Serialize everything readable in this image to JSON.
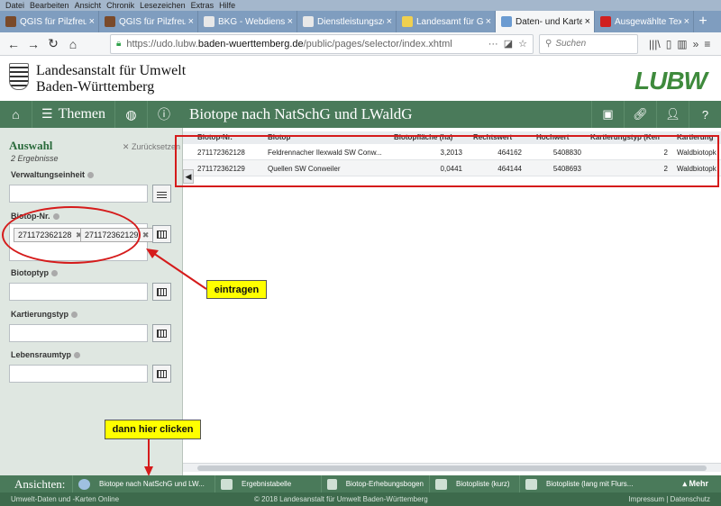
{
  "menubar": [
    "Datei",
    "Bearbeiten",
    "Ansicht",
    "Chronik",
    "Lesezeichen",
    "Extras",
    "Hilfe"
  ],
  "tabs": [
    {
      "label": "QGIS für Pilzfreunde",
      "favicon": "forum-icon",
      "color": "#7a4a2a"
    },
    {
      "label": "QGIS für Pilzfreunde",
      "favicon": "forum-icon",
      "color": "#7a4a2a"
    },
    {
      "label": "BKG - Webdienste",
      "favicon": "bkg-icon",
      "color": "#e8e8e8"
    },
    {
      "label": "Dienstleistungszen",
      "favicon": "lubw-icon",
      "color": "#e8e8e8"
    },
    {
      "label": "Landesamt für Geo",
      "favicon": "lgl-icon",
      "color": "#f0d050"
    },
    {
      "label": "Daten- und Karten",
      "favicon": "map-icon",
      "color": "#6b9bd1",
      "active": true
    },
    {
      "label": "Ausgewählte Texte",
      "favicon": "zt-icon",
      "color": "#d02020"
    }
  ],
  "browser": {
    "url_prefix": "https://udo.lubw.",
    "url_domain": "baden-wuerttemberg.de",
    "url_path": "/public/pages/selector/index.xhtml",
    "search_placeholder": "Suchen"
  },
  "header": {
    "org_line1": "Landesanstalt für Umwelt",
    "org_line2": "Baden-Württemberg",
    "logo_text": "LUBW"
  },
  "toolbar": {
    "themen_label": "Themen",
    "page_title": "Biotope nach NatSchG und LWaldG"
  },
  "filter": {
    "title": "Auswahl",
    "reset_label": "Zurücksetzen",
    "result_count": "2 Ergebnisse",
    "fields": {
      "verwaltungseinheit": "Verwaltungseinheit",
      "biotop_nr": "Biotop-Nr.",
      "biotoptyp": "Biotoptyp",
      "kartierungstyp": "Kartierungstyp",
      "lebensraumtyp": "Lebensraumtyp"
    },
    "selected_tags": [
      "271172362128",
      "271172362129"
    ]
  },
  "table": {
    "columns": [
      "Biotop-Nr.",
      "Biotop",
      "Biotopfläche (ha)",
      "Rechtswert",
      "Hochwert",
      "Kartierungstyp (Ken",
      "Kartierung"
    ],
    "rows": [
      [
        "271172362128",
        "Feldrennacher Ilexwald SW Conw...",
        "3,2013",
        "464162",
        "5408830",
        "2",
        "Waldbiotopk"
      ],
      [
        "271172362129",
        "Quellen SW Conweiler",
        "0,0441",
        "464144",
        "5408693",
        "2",
        "Waldbiotopk"
      ]
    ]
  },
  "annotations": {
    "eintragen": "eintragen",
    "dann_hier_clicken": "dann hier clicken"
  },
  "views": {
    "label": "Ansichten:",
    "items": [
      "Biotope nach NatSchG und LW...",
      "Ergebnistabelle",
      "Biotop-Erhebungsbogen",
      "Biotopliste (kurz)",
      "Biotopliste (lang mit Flurs..."
    ],
    "more": "Mehr"
  },
  "footer": {
    "left": "Umwelt-Daten und -Karten Online",
    "center": "© 2018 Landesanstalt für Umwelt Baden-Württemberg",
    "right": "Impressum | Datenschutz"
  },
  "colors": {
    "green_bar": "#4a7a5a",
    "annotation_red": "#d51b1b",
    "callout_yellow": "#ffff00"
  }
}
